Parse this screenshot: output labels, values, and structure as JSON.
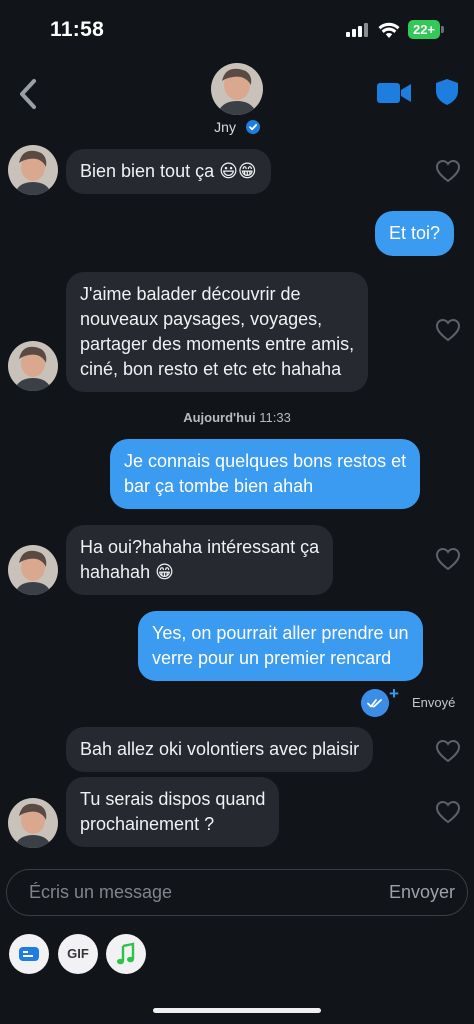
{
  "status_bar": {
    "time": "11:58",
    "battery": "22+"
  },
  "header": {
    "name": "Jny"
  },
  "day_separator": {
    "day": "Aujourd'hui",
    "time": "11:33"
  },
  "messages": [
    {
      "text": "Bien bien tout ça 😃😁"
    },
    {
      "text": "Et toi?"
    },
    {
      "text": "J'aime balader découvrir de\nnouveaux paysages, voyages,\npartager des moments entre amis,\nciné, bon resto et etc etc hahaha"
    },
    {
      "text": "Je connais quelques bons restos et\nbar ça tombe bien ahah"
    },
    {
      "text": "Ha oui?hahaha intéressant ça\nhahahah 😁"
    },
    {
      "text": "Yes, on pourrait aller prendre un\nverre pour un premier rencard"
    },
    {
      "text": "Bah allez oki volontiers avec plaisir"
    },
    {
      "text": "Tu serais dispos quand\nprochainement ?"
    }
  ],
  "read_receipt": {
    "label": "Envoyé",
    "plus": "+"
  },
  "composer": {
    "placeholder": "Écris un message",
    "send_label": "Envoyer"
  },
  "toolbar": {
    "gif_label": "GIF"
  },
  "colors": {
    "outgoing": "#3b9bf0",
    "incoming": "#26292f",
    "background": "#111419",
    "accent": "#1d7ee0"
  },
  "icons": [
    "back-chevron-icon",
    "video-call-icon",
    "shield-icon",
    "verified-badge-icon",
    "heart-icon",
    "read-checkmarks-icon",
    "contact-card-icon",
    "music-note-icon"
  ]
}
